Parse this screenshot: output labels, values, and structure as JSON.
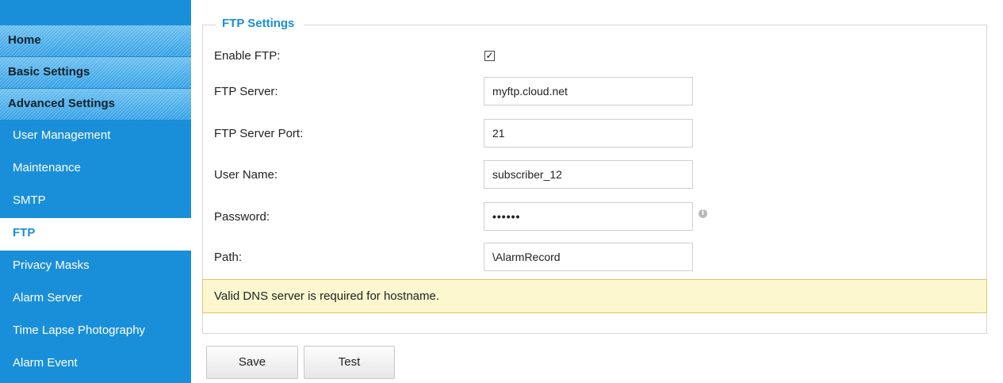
{
  "sidebar": {
    "sections": [
      {
        "label": "Home"
      },
      {
        "label": "Basic Settings"
      },
      {
        "label": "Advanced Settings"
      }
    ],
    "items": [
      {
        "label": "User Management"
      },
      {
        "label": "Maintenance"
      },
      {
        "label": "SMTP"
      },
      {
        "label": "FTP",
        "active": true
      },
      {
        "label": "Privacy Masks"
      },
      {
        "label": "Alarm Server"
      },
      {
        "label": "Time Lapse Photography"
      },
      {
        "label": "Alarm Event"
      }
    ]
  },
  "ftp": {
    "legend": "FTP Settings",
    "enable_label": "Enable FTP:",
    "enable_checked": true,
    "server_label": "FTP Server:",
    "server_value": "myftp.cloud.net",
    "port_label": "FTP Server Port:",
    "port_value": "21",
    "user_label": "User Name:",
    "user_value": "subscriber_12",
    "password_label": "Password:",
    "password_value": "••••••",
    "path_label": "Path:",
    "path_value": "\\AlarmRecord",
    "notice": "Valid DNS server is required for hostname."
  },
  "buttons": {
    "save": "Save",
    "test": "Test"
  },
  "colors": {
    "sidebar_bg": "#1a8fd9",
    "accent": "#1a8fd9",
    "notice_bg": "#fcf7cf",
    "notice_border": "#e2c46a"
  }
}
